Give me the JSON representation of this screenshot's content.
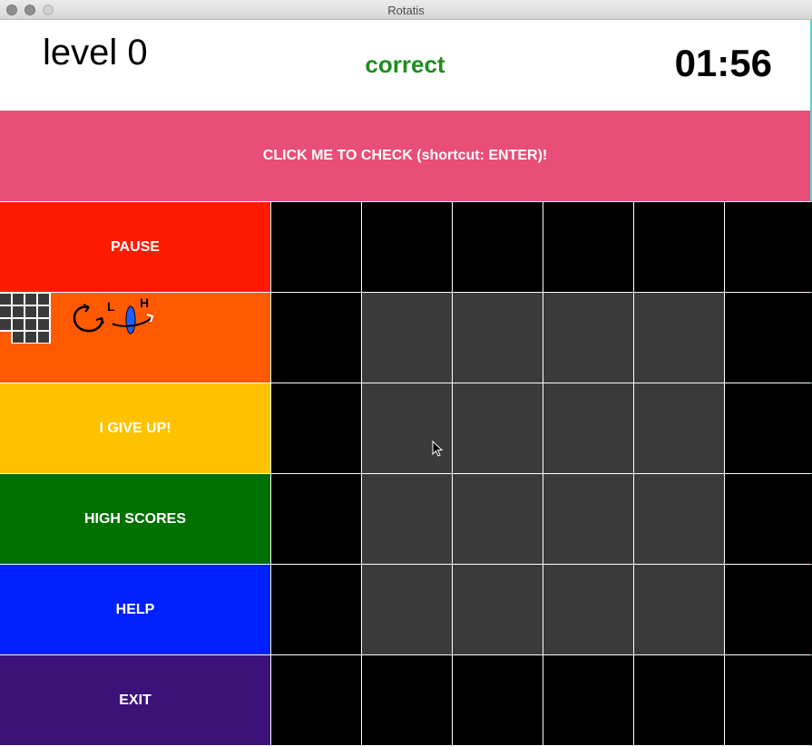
{
  "window": {
    "title": "Rotatis"
  },
  "header": {
    "level": "level 0",
    "status": "correct",
    "timer": "01:56"
  },
  "check_button": {
    "label": "CLICK ME TO CHECK (shortcut: ENTER)!"
  },
  "sidebar": {
    "pause": "PAUSE",
    "give_up": "I GIVE UP!",
    "high_scores": "HIGH SCORES",
    "help": "HELP",
    "exit": "EXIT",
    "rotation_labels": {
      "left": "L",
      "right": "H"
    }
  },
  "board": {
    "rows": 6,
    "cols": 6,
    "active_region": {
      "rows": [
        1,
        4
      ],
      "cols": [
        1,
        4
      ]
    }
  },
  "colors": {
    "check": "#e84e78",
    "pause": "#ff1a00",
    "rotate_panel": "#ff5a00",
    "give_up": "#ffc200",
    "high_scores": "#007000",
    "help": "#0020ff",
    "exit": "#3c1278",
    "status": "#228b22",
    "cell_outer": "#000000",
    "cell_inner": "#3a3a3a"
  }
}
